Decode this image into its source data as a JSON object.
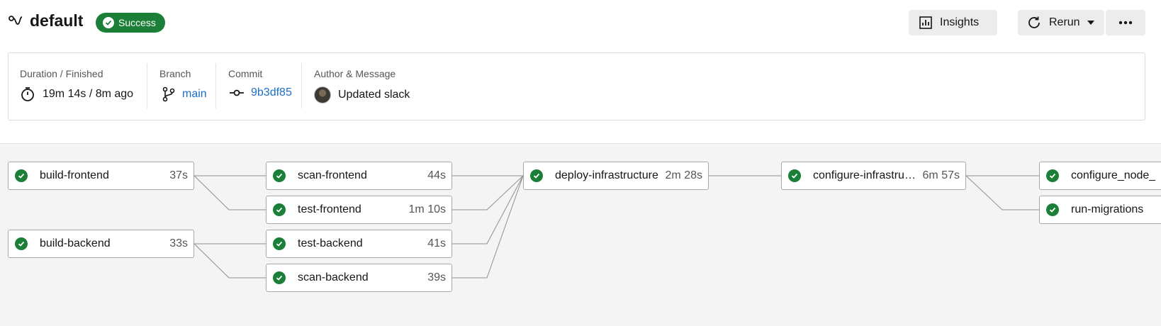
{
  "header": {
    "title": "default",
    "status": "Success",
    "insights_label": "Insights",
    "rerun_label": "Rerun"
  },
  "info": {
    "duration_label": "Duration / Finished",
    "duration_value": "19m 14s / 8m ago",
    "branch_label": "Branch",
    "branch_value": "main",
    "commit_label": "Commit",
    "commit_value": "9b3df85",
    "author_label": "Author & Message",
    "message": "Updated slack"
  },
  "jobs": {
    "build_frontend": {
      "name": "build-frontend",
      "duration": "37s"
    },
    "build_backend": {
      "name": "build-backend",
      "duration": "33s"
    },
    "scan_frontend": {
      "name": "scan-frontend",
      "duration": "44s"
    },
    "test_frontend": {
      "name": "test-frontend",
      "duration": "1m 10s"
    },
    "test_backend": {
      "name": "test-backend",
      "duration": "41s"
    },
    "scan_backend": {
      "name": "scan-backend",
      "duration": "39s"
    },
    "deploy_infrastructure": {
      "name": "deploy-infrastructure",
      "duration": "2m 28s"
    },
    "configure_infrastructure": {
      "name": "configure-infrastructure",
      "duration": "6m 57s"
    },
    "configure_node_exporter": {
      "name": "configure_node_exporter",
      "duration": ""
    },
    "run_migrations": {
      "name": "run-migrations",
      "duration": ""
    }
  },
  "colors": {
    "success": "#1b7f37",
    "link": "#1a6fc9",
    "graph_bg": "#f4f4f4"
  }
}
